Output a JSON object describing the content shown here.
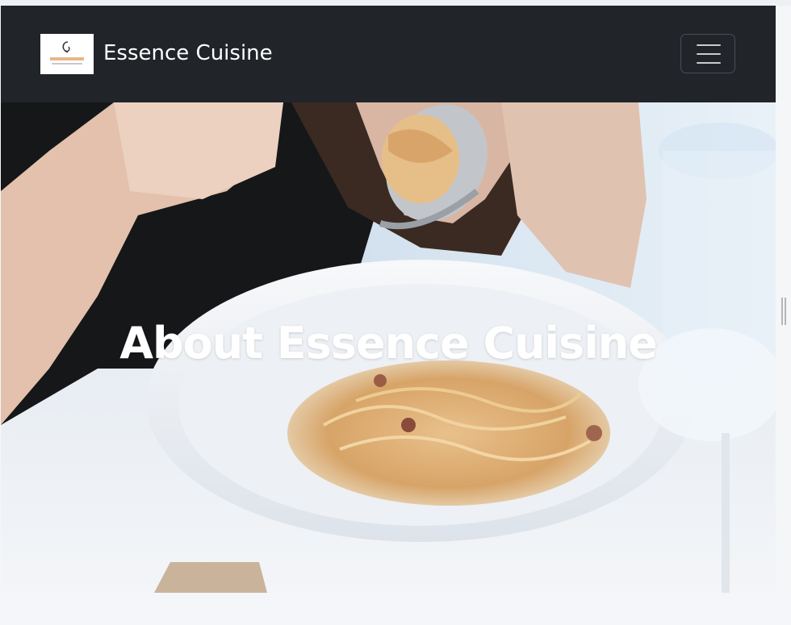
{
  "navbar": {
    "logo_icon": "essence-cuisine-logo",
    "brand_name": "Essence Cuisine",
    "toggler_icon": "hamburger-menu-icon",
    "background_color": "#212429"
  },
  "hero": {
    "title": "About Essence Cuisine",
    "image_subject": "pasta-dish-photo"
  }
}
